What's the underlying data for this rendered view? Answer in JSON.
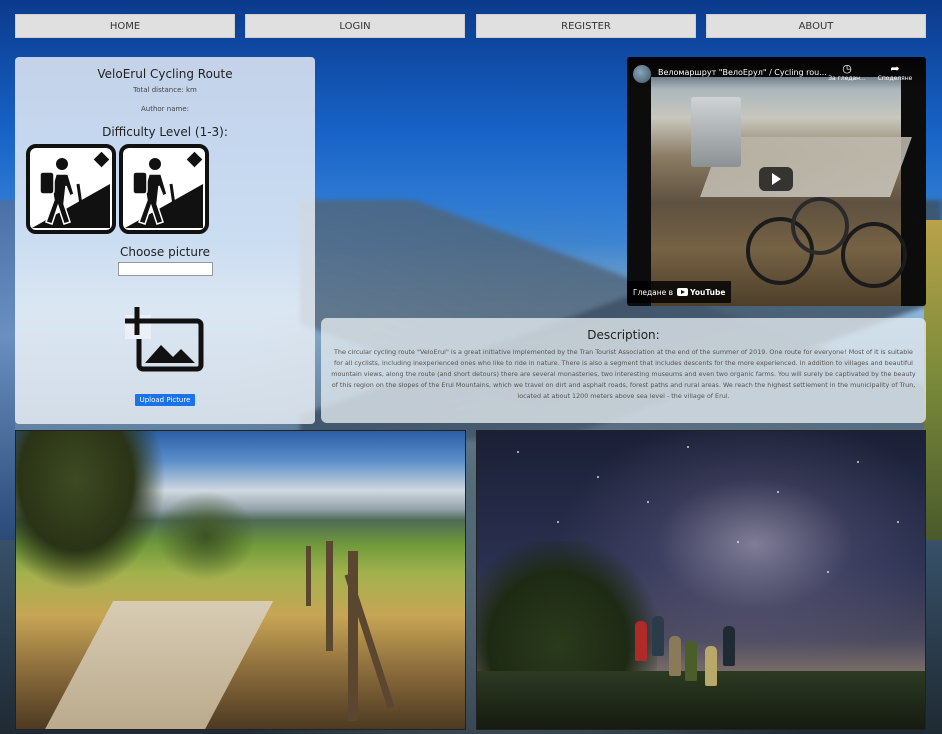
{
  "nav": {
    "home": "HOME",
    "login": "LOGIN",
    "register": "REGISTER",
    "about": "ABOUT"
  },
  "route": {
    "title": "VeloErul Cycling Route",
    "distance": "Total distance: km",
    "author": "Author name:",
    "difficulty_title": "Difficulty Level (1-3):",
    "difficulty_level": 2,
    "choose_picture": "Choose picture",
    "upload_button": "Upload Picture"
  },
  "video": {
    "title": "Веломаршрут \"ВелоЕрул\" / Cycling rou...",
    "watch_later": "За гледан...",
    "share": "Споделяне",
    "watch_on": "Гледане в",
    "youtube": "YouTube"
  },
  "description": {
    "title": "Description:",
    "text": "The circular cycling route \"VeloErul\" is a great initiative implemented by the Tran Tourist Association at the end of the summer of 2019. One route for everyone! Most of it is suitable for all cyclists, including inexperienced ones who like to ride in nature. There is also a segment that includes descents for the more experienced. In addition to villages and beautiful mountain views, along the route (and short detours) there are several monasteries, two interesting museums and even two organic farms. You will surely be captivated by the beauty of this region on the slopes of the Erul Mountains, which we travel on dirt and asphalt roads, forest paths and rural areas. We reach the highest settlement in the municipality of Trun, located at about 1200 meters above sea level - the village of Erul."
  },
  "icons": {
    "hiker": "hiker-icon",
    "add_photo": "add-photo-icon",
    "clock": "clock-icon",
    "share": "share-icon",
    "play": "play-icon"
  },
  "colors": {
    "upload_button": "#1a73e8",
    "nav_button": "#e0e0e0"
  }
}
